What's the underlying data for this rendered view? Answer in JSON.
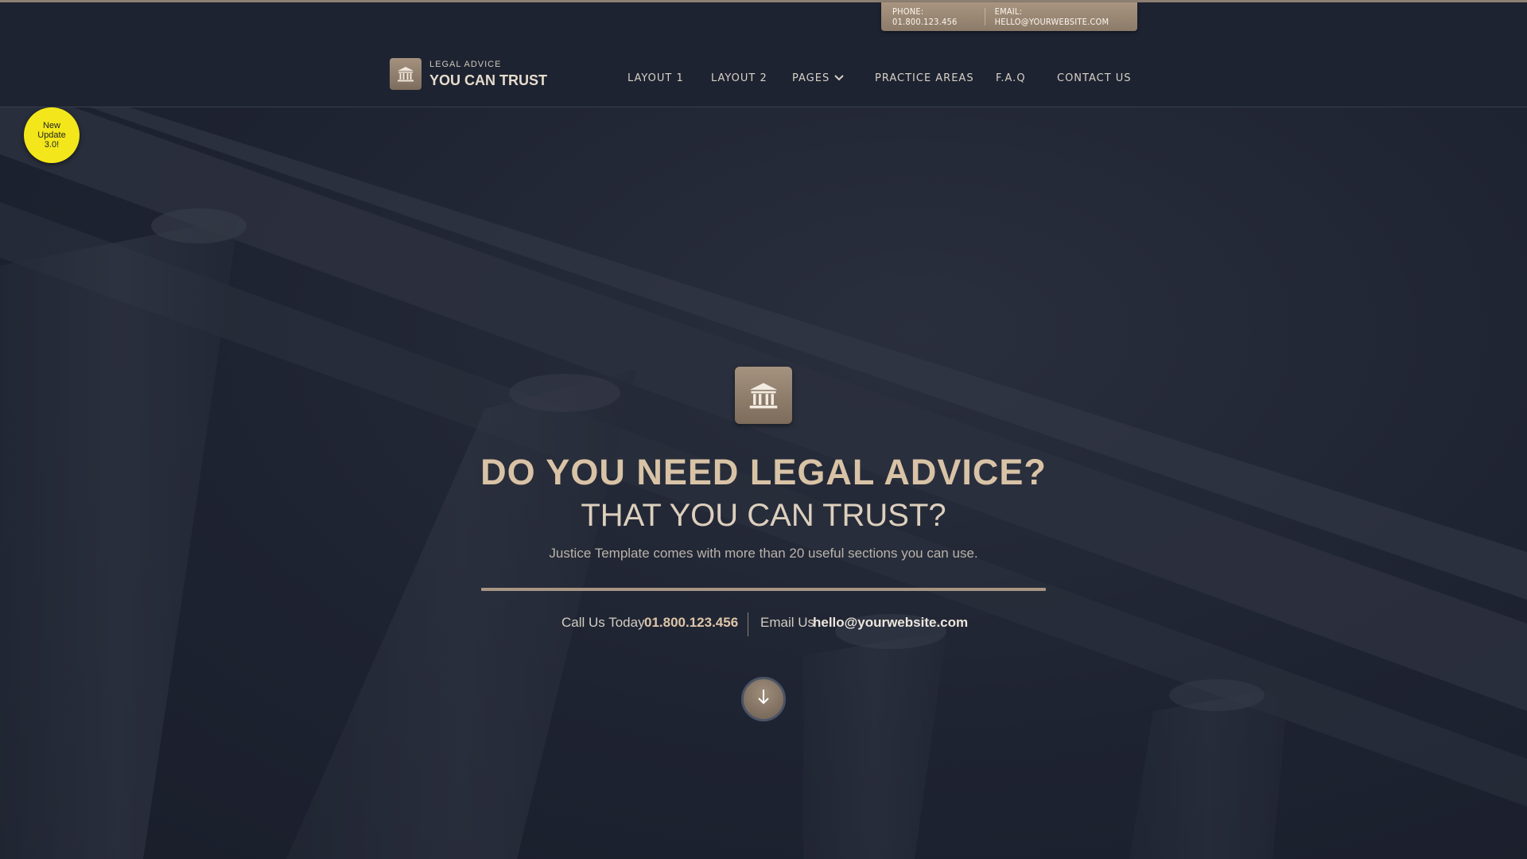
{
  "topbar": {
    "phone": "PHONE: 01.800.123.456",
    "email": "EMAIL: HELLO@YOURWEBSITE.COM"
  },
  "logo": {
    "small": "LEGAL ADVICE",
    "big": "YOU CAN TRUST",
    "icon": "courthouse-icon"
  },
  "nav": {
    "items": [
      "LAYOUT 1",
      "LAYOUT 2",
      "PAGES",
      "PRACTICE AREAS",
      "F.A.Q",
      "CONTACT US"
    ]
  },
  "badge": {
    "line1": "New",
    "line2": "Update",
    "line3": "3.0!"
  },
  "hero": {
    "icon": "courthouse-icon",
    "headline": "DO YOU NEED LEGAL ADVICE?",
    "subhead": "THAT YOU CAN TRUST?",
    "tagline": "Justice Template comes with more than 20 useful sections you can use.",
    "call_label": "Call Us Today",
    "call_value": "01.800.123.456",
    "email_label": "Email Us",
    "email_value": "hello@yourwebsite.com",
    "scroll_icon": "arrow-down-icon"
  },
  "colors": {
    "background": "#1f2433",
    "accent": "#a89683",
    "badge": "#f3e71b",
    "headline": "#d9c3a6"
  }
}
